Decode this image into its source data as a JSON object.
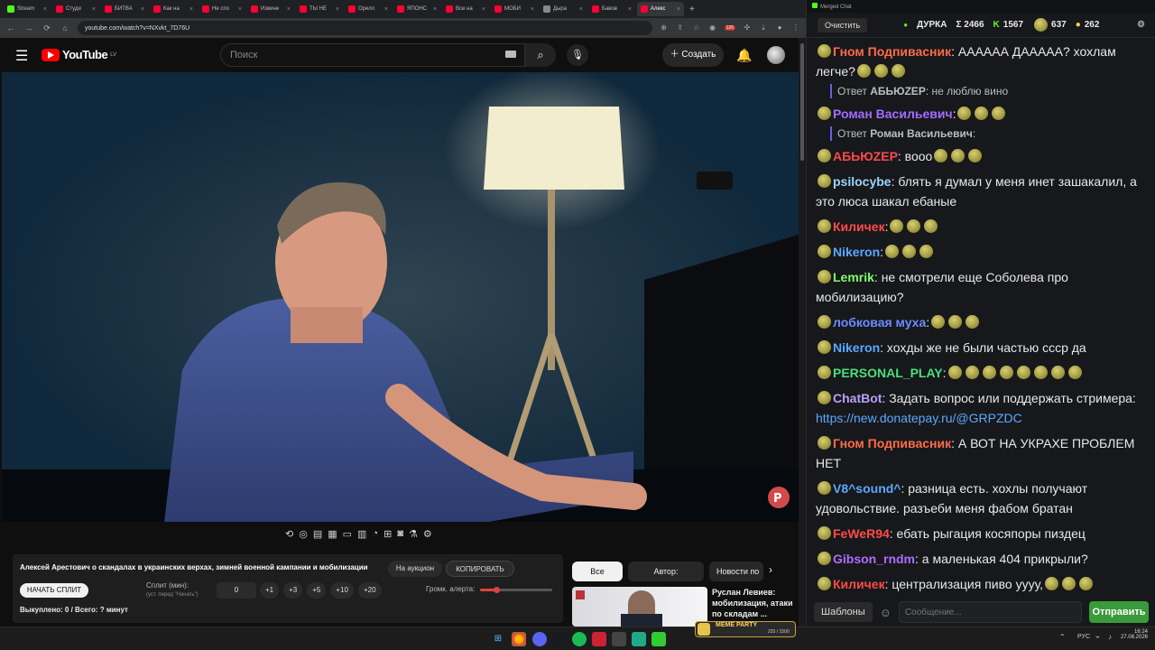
{
  "browser": {
    "tabs": [
      {
        "label": "Stream",
        "color": "#53fc18"
      },
      {
        "label": "Студи",
        "color": "#ff0033"
      },
      {
        "label": "БИТВА",
        "color": "#ff0033"
      },
      {
        "label": "Как на",
        "color": "#ff0033"
      },
      {
        "label": "Не спо",
        "color": "#ff0033"
      },
      {
        "label": "Извине",
        "color": "#ff0033"
      },
      {
        "label": "ТЫ НЕ",
        "color": "#ff0033"
      },
      {
        "label": "Орелл",
        "color": "#ff0033"
      },
      {
        "label": "ЯПОНС",
        "color": "#ff0033"
      },
      {
        "label": "Все на",
        "color": "#ff0033"
      },
      {
        "label": "МОБИ",
        "color": "#ff0033"
      },
      {
        "label": "Дыра",
        "color": "#888888"
      },
      {
        "label": "Бавов",
        "color": "#ff0033"
      },
      {
        "label": "Алекс",
        "color": "#ff0033"
      }
    ],
    "url": "youtube.com/watch?v=NXvkt_7D76U",
    "ext_badge": "126"
  },
  "youtube": {
    "logo": "YouTube",
    "region": "LV",
    "search_placeholder": "Поиск",
    "create_label": "Создать",
    "video_title": "Алексей Арестович о скандалах в украинских верхах, зимней военной кампании и мобилизации",
    "auction_label": "На аукцион",
    "copy_label": "КОПИРОВАТЬ",
    "split_start_label": "НАЧАТЬ СПЛИТ",
    "split_min_label": "Сплит (мин):",
    "split_hint": "(уст. перед \"Начать\")",
    "split_value": "0",
    "increments": [
      "+1",
      "+3",
      "+5",
      "+10",
      "+20"
    ],
    "alert_volume_label": "Громк. алерта:",
    "alert_volume_level": 0.22,
    "bought_label": "Выкуплено: 0 / Всего: ? минут",
    "chips": [
      "Все видео",
      "Автор: Редакция",
      "Новости по"
    ],
    "rec_title": "Руслан Левиев: мобилизация, атаки по складам ...",
    "meme_label": "MEME PARTY",
    "meme_progress": "225 / 1500"
  },
  "chat": {
    "window_title": "Merged Chat",
    "clear_label": "Очистить",
    "channel": "ДУРКА",
    "stats": [
      "Σ 2466",
      "1567",
      "637",
      "262"
    ],
    "messages": [
      {
        "name": "Гном Подпивасник",
        "color": "#ff6b4a",
        "text": ": АААААА ДААААА? хохлам легче?",
        "emotes": 3
      },
      {
        "reply": true,
        "prefix": "Ответ",
        "name": "АБЬЮZEP",
        "text": ": не люблю вино"
      },
      {
        "name": "Роман Васильевич",
        "color": "#a36bff",
        "text": ":",
        "emotes": 3
      },
      {
        "reply": true,
        "prefix": "Ответ",
        "name": "Роман Васильевич",
        "text": ":"
      },
      {
        "name": "АБЬЮZEP",
        "color": "#ff4a4a",
        "text": ": вооо",
        "emotes": 3
      },
      {
        "name": "psilocybe",
        "color": "#9ad4ff",
        "text": ": блять я думал у меня инет зашакалил, а это люса шакал ебаные",
        "emotes": 0
      },
      {
        "name": "Киличек",
        "color": "#ff4a4a",
        "text": ":",
        "emotes": 3
      },
      {
        "name": "Nikeron",
        "color": "#5aa9ff",
        "text": ":",
        "emotes": 3
      },
      {
        "name": "Lemrik",
        "color": "#7dff6b",
        "text": ": не смотрели еще Соболева про мобилизацию?",
        "emotes": 0
      },
      {
        "name": "лобковая муха",
        "color": "#6b8cff",
        "text": ":",
        "emotes": 3
      },
      {
        "name": "Nikeron",
        "color": "#5aa9ff",
        "text": ": хохды же не были частью ссср да",
        "emotes": 0
      },
      {
        "name": "PERSONAL_PLAY",
        "color": "#4adf7a",
        "text": ":",
        "emotes": 8
      },
      {
        "name": "ChatBot",
        "color": "#b9a0ff",
        "text": ": Задать вопрос или поддержать стримера: ",
        "link": "https://new.donatepay.ru/@GRPZDC",
        "emotes": 0
      },
      {
        "name": "Гном Подпивасник",
        "color": "#ff6b4a",
        "text": ": А ВОТ НА УКРАХЕ ПРОБЛЕМ НЕТ",
        "emotes": 0
      },
      {
        "name": "V8^sound^",
        "color": "#5aa9ff",
        "text": ": разница есть. хохлы получают удовольствие. разъеби меня фабом братан",
        "emotes": 0
      },
      {
        "name": "FeWeR94",
        "color": "#ff4a4a",
        "text": ": ебать рыгация косяпоры пиздец",
        "emotes": 0
      },
      {
        "name": "Gibson_rndm",
        "color": "#b06bff",
        "text": ": а маленькая 404 прикрыли?",
        "emotes": 0
      },
      {
        "name": "Киличек",
        "color": "#ff4a4a",
        "text": ": централизация пиво уууу,",
        "emotes": 3
      }
    ],
    "templates_label": "Шаблоны",
    "input_placeholder": "Сообщение...",
    "send_label": "Отправить"
  },
  "taskbar": {
    "lang": "РУС",
    "time": "16:24",
    "date": "27.08.2026"
  }
}
